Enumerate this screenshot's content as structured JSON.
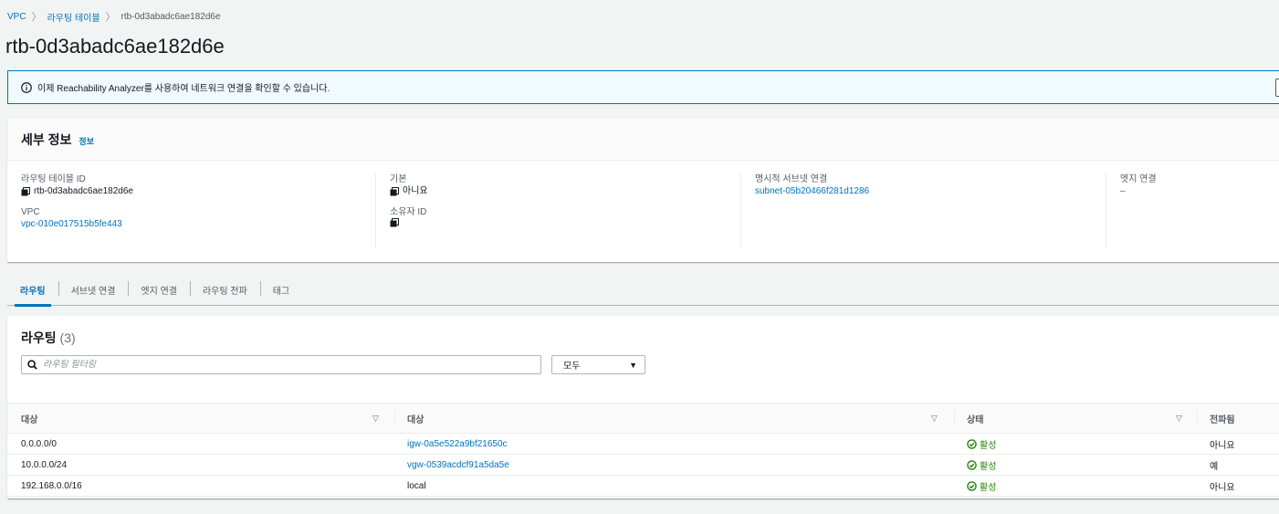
{
  "breadcrumb": {
    "root": "VPC",
    "parent": "라우팅 테이블",
    "current": "rtb-0d3abadc6ae182d6e"
  },
  "page_title": "rtb-0d3abadc6ae182d6e",
  "flash": {
    "message": "이제 Reachability Analyzer를 사용하여 네트워크 연결을 확인할 수 있습니다."
  },
  "details": {
    "title": "세부 정보",
    "info_link": "정보",
    "route_table_id_label": "라우팅 테이블 ID",
    "route_table_id": "rtb-0d3abadc6ae182d6e",
    "vpc_label": "VPC",
    "vpc": "vpc-010e017515b5fe443",
    "main_label": "기본",
    "main": "아니요",
    "owner_label": "소유자 ID",
    "owner": "",
    "subnet_assoc_label": "명시적 서브넷 연결",
    "subnet_assoc": "subnet-05b20466f281d1286",
    "edge_assoc_label": "엣지 연결",
    "edge_assoc": "–"
  },
  "tabs": [
    "라우팅",
    "서브넷 연결",
    "엣지 연결",
    "라우팅 전파",
    "태그"
  ],
  "routes": {
    "title": "라우팅",
    "count": "(3)",
    "search_placeholder": "라우팅 필터링",
    "filter_value": "모두",
    "columns": [
      "대상",
      "대상",
      "상태",
      "전파됨"
    ],
    "rows": [
      {
        "destination": "0.0.0.0/0",
        "target": "igw-0a5e522a9bf21650c",
        "target_link": true,
        "status": "활성",
        "propagated": "아니요"
      },
      {
        "destination": "10.0.0.0/24",
        "target": "vgw-0539acdcf91a5da5e",
        "target_link": true,
        "status": "활성",
        "propagated": "예"
      },
      {
        "destination": "192.168.0.0/16",
        "target": "local",
        "target_link": false,
        "status": "활성",
        "propagated": "아니요"
      }
    ]
  },
  "colors": {
    "link": "#0073bb",
    "success": "#1d8102",
    "info_border": "#0073bb",
    "info_bg": "#f1faff"
  }
}
